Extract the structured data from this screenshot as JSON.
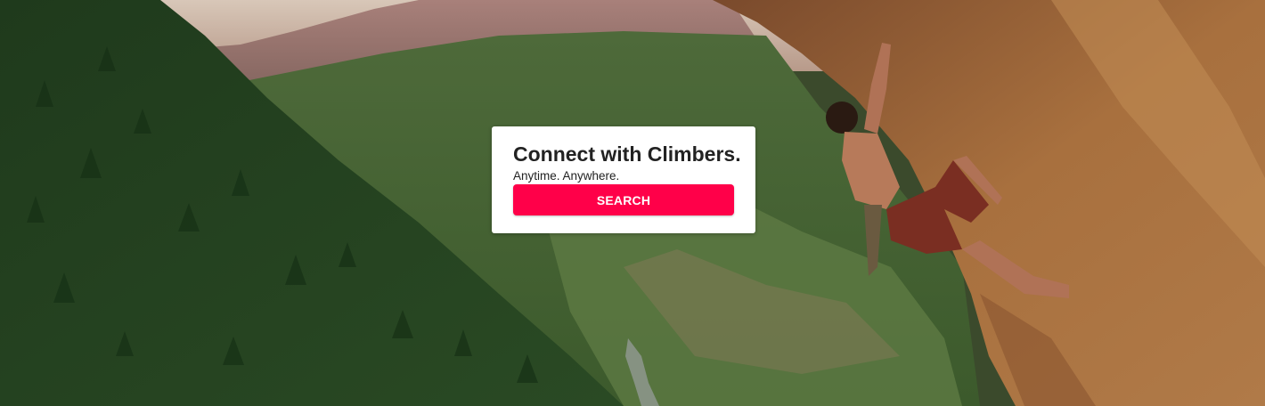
{
  "hero": {
    "title": "Connect with Climbers.",
    "subtitle": "Anytime. Anywhere.",
    "search_label": "SEARCH",
    "accent_color": "#ff0049"
  }
}
